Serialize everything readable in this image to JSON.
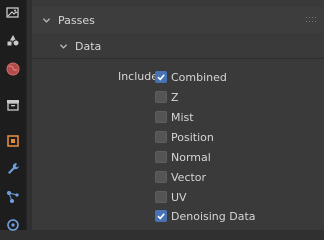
{
  "tabs": [
    {
      "id": "render",
      "icon": "render-icon"
    },
    {
      "id": "output",
      "icon": "output-icon"
    },
    {
      "id": "view_layer",
      "icon": "view-layer-icon"
    },
    {
      "id": "scene",
      "icon": "scene-icon"
    },
    {
      "id": "world",
      "icon": "world-icon"
    },
    {
      "id": "collection",
      "icon": "collection-icon"
    },
    {
      "id": "object",
      "icon": "object-icon"
    },
    {
      "id": "modifiers",
      "icon": "wrench-icon"
    },
    {
      "id": "particles",
      "icon": "particles-icon"
    },
    {
      "id": "physics",
      "icon": "physics-icon"
    }
  ],
  "panel": {
    "title": "Passes",
    "subpanel": {
      "title": "Data",
      "include_label": "Include",
      "items": [
        {
          "label": "Combined",
          "checked": true
        },
        {
          "label": "Z",
          "checked": false
        },
        {
          "label": "Mist",
          "checked": false
        },
        {
          "label": "Position",
          "checked": false
        },
        {
          "label": "Normal",
          "checked": false
        },
        {
          "label": "Vector",
          "checked": false
        },
        {
          "label": "UV",
          "checked": false
        },
        {
          "label": "Denoising Data",
          "checked": true
        }
      ]
    }
  },
  "colors": {
    "accent": "#4772b3",
    "panel_bg": "#3a3a3a",
    "tabbar_bg": "#1d1d1d"
  }
}
